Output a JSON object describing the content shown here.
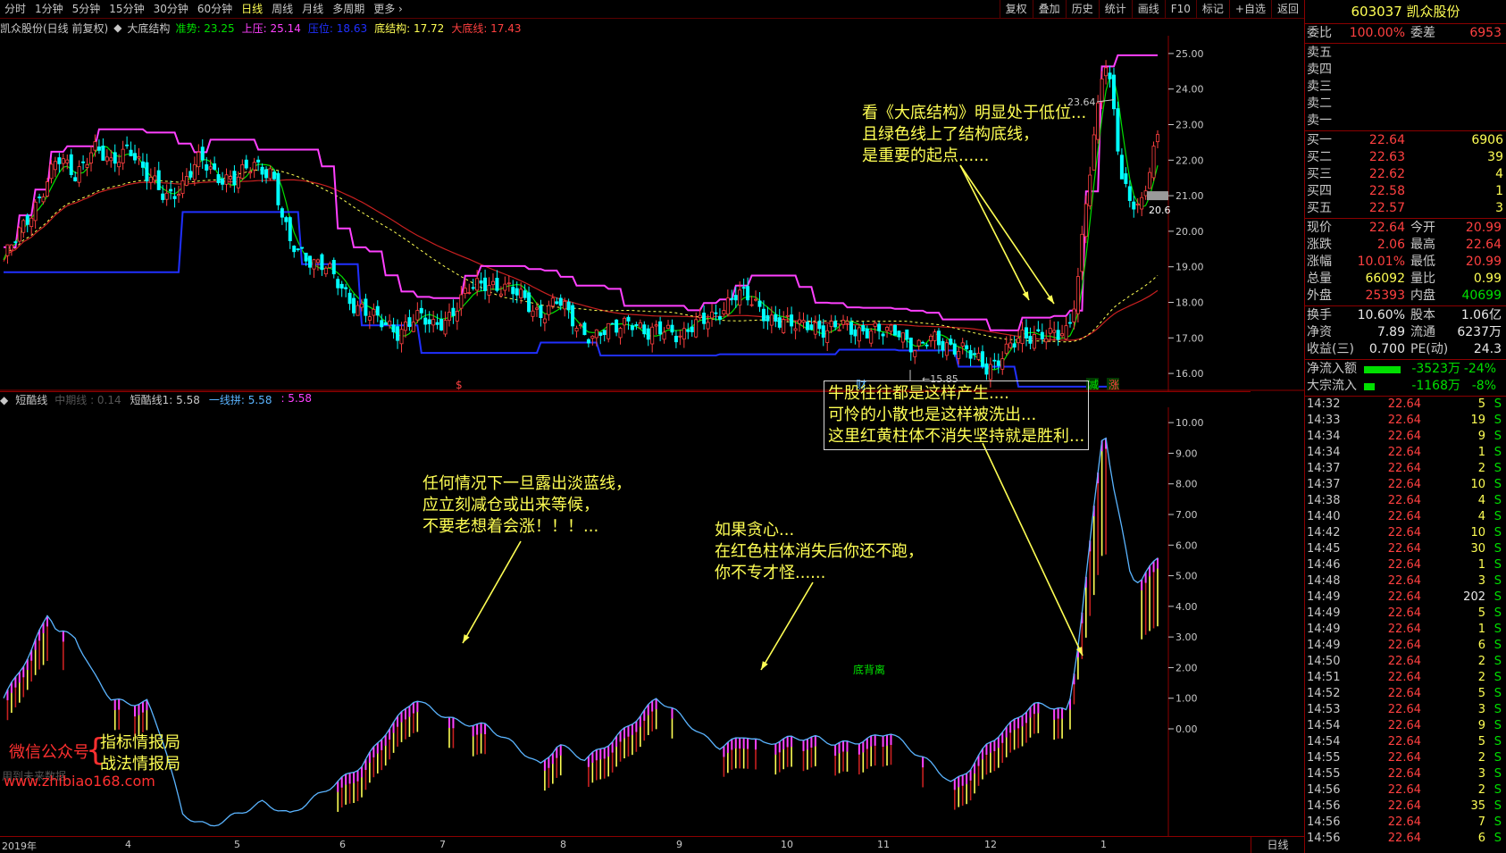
{
  "toolbar": {
    "periods": [
      "分时",
      "1分钟",
      "5分钟",
      "15分钟",
      "30分钟",
      "60分钟",
      "日线",
      "周线",
      "月线",
      "多周期",
      "更多"
    ],
    "active_period": "日线",
    "actions": [
      "复权",
      "叠加",
      "历史",
      "统计",
      "画线",
      "F10",
      "标记",
      "+自选",
      "返回"
    ]
  },
  "main_header": {
    "title": "凯众股份(日线 前复权)",
    "indicator": "大底结构",
    "values": [
      {
        "label": "准势: 23.25",
        "color": "#00e000"
      },
      {
        "label": "上压: 25.14",
        "color": "#ff40ff"
      },
      {
        "label": "压位: 18.63",
        "color": "#2030ff"
      },
      {
        "label": "底结构: 17.72",
        "color": "#ffff54"
      },
      {
        "label": "大底线: 17.43",
        "color": "#ff4040"
      }
    ]
  },
  "sub_header": {
    "name": "短酷线",
    "values": [
      {
        "label": "中期线 : 0.14",
        "color": "#555555"
      },
      {
        "label": "短酷线1: 5.58",
        "color": "#c8c8c8"
      },
      {
        "label": "一线拼: 5.58",
        "color": "#5ab4ff"
      },
      {
        "label": ": 5.58",
        "color": "#ff40ff"
      }
    ]
  },
  "main_axis": {
    "min": 15.5,
    "max": 25.5,
    "ticks": [
      "16.00",
      "17.00",
      "18.00",
      "19.00",
      "20.00",
      "21.00",
      "22.00",
      "23.00",
      "24.00",
      "25.00"
    ]
  },
  "sub_axis": {
    "min": -3.5,
    "max": 10.5,
    "ticks": [
      "0.00",
      "1.00",
      "2.00",
      "3.00",
      "4.00",
      "5.00",
      "6.00",
      "7.00",
      "8.00",
      "9.00",
      "10.00"
    ]
  },
  "markers": {
    "high_label": "23.64",
    "low_label": "15.85",
    "last_price_tag": "20.6",
    "events": [
      {
        "text": "$",
        "color": "#ff4040",
        "at": 0.35
      },
      {
        "text": "财",
        "color": "#5ab4ff",
        "at": 0.66
      },
      {
        "text": "减",
        "color": "#00e000",
        "at": 0.84
      },
      {
        "text": "涨",
        "color": "#ff4040",
        "at": 0.86
      }
    ],
    "divergence": "底背离"
  },
  "x_axis": {
    "labels": [
      "2019年",
      "4",
      "5",
      "6",
      "7",
      "8",
      "9",
      "10",
      "11",
      "12",
      "1"
    ],
    "period": "日线"
  },
  "annotations": {
    "top": [
      "看《大底结构》明显处于低位...",
      "且绿色线上了结构底线，",
      "是重要的起点......"
    ],
    "sub1": [
      "任何情况下一旦露出淡蓝线，",
      "应立刻减仓或出来等候，",
      "不要老想着会涨！！！..."
    ],
    "sub2": [
      "如果贪心...",
      "在红色柱体消失后你还不跑，",
      "你不专才怪......"
    ],
    "sub3": [
      "牛股往往都是这样产生....",
      "可怜的小散也是这样被洗出...",
      "这里红黄柱体不消失坚持就是胜利..."
    ]
  },
  "watermark": {
    "left": "微信公众号",
    "brace": "{",
    "right1": "指标情报局",
    "right2": "战法情报局",
    "url": "www.zhibiao168.com",
    "faded": "用到未来数据"
  },
  "right_panel": {
    "title": "603037 凯众股份",
    "weibi": {
      "label": "委比",
      "value": "100.00%",
      "label2": "委差",
      "value2": "6953"
    },
    "asks": [
      {
        "label": "卖五",
        "price": "",
        "vol": ""
      },
      {
        "label": "卖四",
        "price": "",
        "vol": ""
      },
      {
        "label": "卖三",
        "price": "",
        "vol": ""
      },
      {
        "label": "卖二",
        "price": "",
        "vol": ""
      },
      {
        "label": "卖一",
        "price": "",
        "vol": ""
      }
    ],
    "bids": [
      {
        "label": "买一",
        "price": "22.64",
        "vol": "6906"
      },
      {
        "label": "买二",
        "price": "22.63",
        "vol": "39"
      },
      {
        "label": "买三",
        "price": "22.62",
        "vol": "4"
      },
      {
        "label": "买四",
        "price": "22.58",
        "vol": "1"
      },
      {
        "label": "买五",
        "price": "22.57",
        "vol": "3"
      }
    ],
    "quote": [
      {
        "l1": "现价",
        "v1": "22.64",
        "c1": "red",
        "l2": "今开",
        "v2": "20.99",
        "c2": "red"
      },
      {
        "l1": "涨跌",
        "v1": "2.06",
        "c1": "red",
        "l2": "最高",
        "v2": "22.64",
        "c2": "red"
      },
      {
        "l1": "涨幅",
        "v1": "10.01%",
        "c1": "red",
        "l2": "最低",
        "v2": "20.99",
        "c2": "red"
      },
      {
        "l1": "总量",
        "v1": "66092",
        "c1": "yellow",
        "l2": "量比",
        "v2": "0.99",
        "c2": "yellow"
      },
      {
        "l1": "外盘",
        "v1": "25393",
        "c1": "red",
        "l2": "内盘",
        "v2": "40699",
        "c2": "green"
      }
    ],
    "fin": [
      {
        "l1": "换手",
        "v1": "10.60%",
        "l2": "股本",
        "v2": "1.06亿"
      },
      {
        "l1": "净资",
        "v1": "7.89",
        "l2": "流通",
        "v2": "6237万"
      },
      {
        "l1": "收益(三)",
        "v1": "0.700",
        "l2": "PE(动)",
        "v2": "24.3"
      }
    ],
    "flows": [
      {
        "label": "净流入额",
        "bar": 0.85,
        "value": "-3523万",
        "pct": "-24%"
      },
      {
        "label": "大宗流入",
        "bar": 0.25,
        "value": "-1168万",
        "pct": "-8%"
      }
    ],
    "trades": [
      {
        "time": "14:32",
        "price": "22.64",
        "vol": "5",
        "side": "S"
      },
      {
        "time": "14:33",
        "price": "22.64",
        "vol": "19",
        "side": "S"
      },
      {
        "time": "14:34",
        "price": "22.64",
        "vol": "9",
        "side": "S"
      },
      {
        "time": "14:34",
        "price": "22.64",
        "vol": "1",
        "side": "S"
      },
      {
        "time": "14:37",
        "price": "22.64",
        "vol": "2",
        "side": "S"
      },
      {
        "time": "14:37",
        "price": "22.64",
        "vol": "10",
        "side": "S"
      },
      {
        "time": "14:38",
        "price": "22.64",
        "vol": "4",
        "side": "S"
      },
      {
        "time": "14:40",
        "price": "22.64",
        "vol": "4",
        "side": "S"
      },
      {
        "time": "14:42",
        "price": "22.64",
        "vol": "10",
        "side": "S"
      },
      {
        "time": "14:45",
        "price": "22.64",
        "vol": "30",
        "side": "S"
      },
      {
        "time": "14:46",
        "price": "22.64",
        "vol": "1",
        "side": "S"
      },
      {
        "time": "14:48",
        "price": "22.64",
        "vol": "3",
        "side": "S"
      },
      {
        "time": "14:49",
        "price": "22.64",
        "vol": "202",
        "side": "S"
      },
      {
        "time": "14:49",
        "price": "22.64",
        "vol": "5",
        "side": "S"
      },
      {
        "time": "14:49",
        "price": "22.64",
        "vol": "1",
        "side": "S"
      },
      {
        "time": "14:49",
        "price": "22.64",
        "vol": "6",
        "side": "S"
      },
      {
        "time": "14:50",
        "price": "22.64",
        "vol": "2",
        "side": "S"
      },
      {
        "time": "14:51",
        "price": "22.64",
        "vol": "2",
        "side": "S"
      },
      {
        "time": "14:52",
        "price": "22.64",
        "vol": "5",
        "side": "S"
      },
      {
        "time": "14:53",
        "price": "22.64",
        "vol": "3",
        "side": "S"
      },
      {
        "time": "14:54",
        "price": "22.64",
        "vol": "9",
        "side": "S"
      },
      {
        "time": "14:54",
        "price": "22.64",
        "vol": "5",
        "side": "S"
      },
      {
        "time": "14:55",
        "price": "22.64",
        "vol": "2",
        "side": "S"
      },
      {
        "time": "14:55",
        "price": "22.64",
        "vol": "3",
        "side": "S"
      },
      {
        "time": "14:56",
        "price": "22.64",
        "vol": "2",
        "side": "S"
      },
      {
        "time": "14:56",
        "price": "22.64",
        "vol": "35",
        "side": "S"
      },
      {
        "time": "14:56",
        "price": "22.64",
        "vol": "7",
        "side": "S"
      },
      {
        "time": "14:56",
        "price": "22.64",
        "vol": "6",
        "side": "S"
      }
    ]
  },
  "colors": {
    "up": "#ff4040",
    "down": "#00ffff",
    "grid": "#8b0000",
    "magenta": "#ff40ff",
    "green": "#00e000",
    "blue": "#2030ff",
    "yellow": "#ffff54",
    "cyan": "#5ab4ff"
  }
}
